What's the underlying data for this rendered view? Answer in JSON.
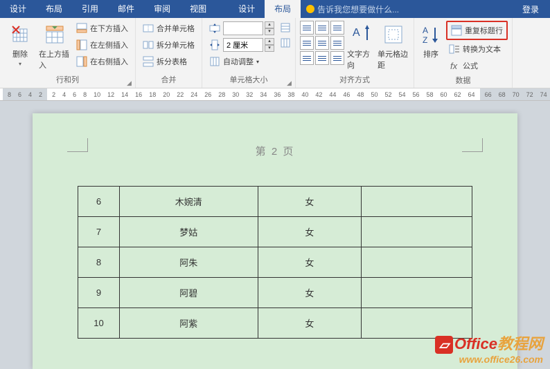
{
  "tabs": [
    "设计",
    "布局",
    "引用",
    "邮件",
    "审阅",
    "视图"
  ],
  "tool_tabs": {
    "design": "设计",
    "layout": "布局"
  },
  "tell_me": "告诉我您想要做什么...",
  "login": "登录",
  "ribbon": {
    "delete": "删除",
    "insert_above": "在上方插入",
    "insert_below": "在下方插入",
    "insert_left": "在左侧插入",
    "insert_right": "在右侧插入",
    "rows_cols": "行和列",
    "merge_cells": "合并单元格",
    "split_cells": "拆分单元格",
    "split_table": "拆分表格",
    "merge": "合并",
    "width_value": "2 厘米",
    "autofit": "自动调整",
    "cell_size": "单元格大小",
    "text_dir": "文字方向",
    "cell_margin": "单元格边距",
    "alignment": "对齐方式",
    "sort": "排序",
    "repeat_header": "重复标题行",
    "convert_text": "转换为文本",
    "formula": "公式",
    "data": "数据"
  },
  "ruler": {
    "dark_left": [
      "8",
      "6",
      "4",
      "2"
    ],
    "light": [
      "2",
      "4",
      "6",
      "8",
      "10",
      "12",
      "14",
      "16",
      "18",
      "20",
      "22",
      "24",
      "26",
      "28",
      "30",
      "32",
      "34",
      "36",
      "38",
      "40",
      "42",
      "44",
      "46",
      "48",
      "50",
      "52",
      "54",
      "56",
      "58",
      "60",
      "62",
      "64"
    ],
    "dark_right": [
      "66",
      "68",
      "70",
      "72",
      "74"
    ]
  },
  "page": {
    "header": "第 2 页"
  },
  "table_rows": [
    {
      "n": "6",
      "name": "木婉清",
      "g": "女",
      "note": ""
    },
    {
      "n": "7",
      "name": "梦姑",
      "g": "女",
      "note": ""
    },
    {
      "n": "8",
      "name": "阿朱",
      "g": "女",
      "note": ""
    },
    {
      "n": "9",
      "name": "阿碧",
      "g": "女",
      "note": ""
    },
    {
      "n": "10",
      "name": "阿紫",
      "g": "女",
      "note": ""
    }
  ],
  "watermark": {
    "line1a": "Office",
    "line1b": "教程网",
    "line2": "www.office26.com"
  }
}
